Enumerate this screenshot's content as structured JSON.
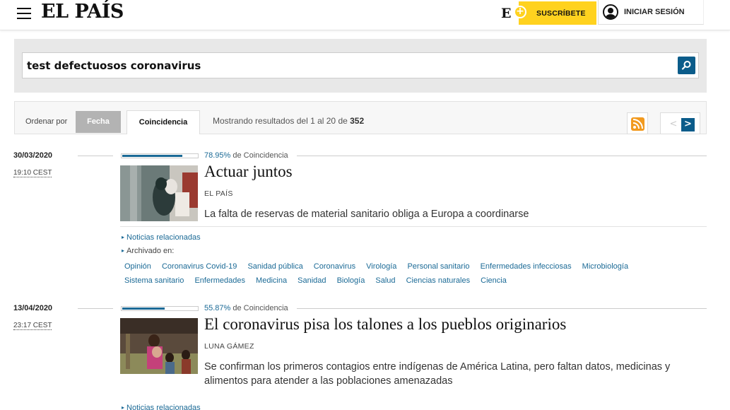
{
  "header": {
    "logo": "EL PAÍS",
    "e_logo": "E",
    "subscribe": "SUSCRÍBETE",
    "login": "INICIAR SESIÓN"
  },
  "search": {
    "query": "test defectuosos coronavirus"
  },
  "sortbar": {
    "label": "Ordenar por",
    "fecha": "Fecha",
    "coincidencia": "Coincidencia",
    "count_prefix": "Mostrando resultados del 1 al 20 de ",
    "count_total": "352",
    "prev": "<",
    "next": ">"
  },
  "results": [
    {
      "date": "30/03/2020",
      "time": "19:10 CEST",
      "match_pct": "78.95%",
      "match_fraction": 0.7895,
      "match_label": " de Coincidencia",
      "title": "Actuar juntos",
      "author": "EL PAÍS",
      "description": "La falta de reservas de material sanitario obliga a Europa a coordinarse",
      "related": "Noticias relacionadas",
      "archived": "Archivado en:",
      "tags": [
        "Opinión",
        "Coronavirus Covid-19",
        "Sanidad pública",
        "Coronavirus",
        "Virología",
        "Personal sanitario",
        "Enfermedades infecciosas",
        "Microbiología",
        "Sistema sanitario",
        "Enfermedades",
        "Medicina",
        "Sanidad",
        "Biología",
        "Salud",
        "Ciencias naturales",
        "Ciencia"
      ]
    },
    {
      "date": "13/04/2020",
      "time": "23:17 CEST",
      "match_pct": "55.87%",
      "match_fraction": 0.5587,
      "match_label": " de Coincidencia",
      "title": "El coronavirus pisa los talones a los pueblos originarios",
      "author": "LUNA GÁMEZ",
      "description": "Se confirman los primeros contagios entre indígenas de América Latina, pero faltan datos, medicinas y alimentos para atender a las poblaciones amenazadas",
      "related": "Noticias relacionadas"
    }
  ],
  "colors": {
    "accent": "#1b6a96",
    "subscribe_yellow": "#ffd21f",
    "rss_orange": "#f29a1f"
  }
}
